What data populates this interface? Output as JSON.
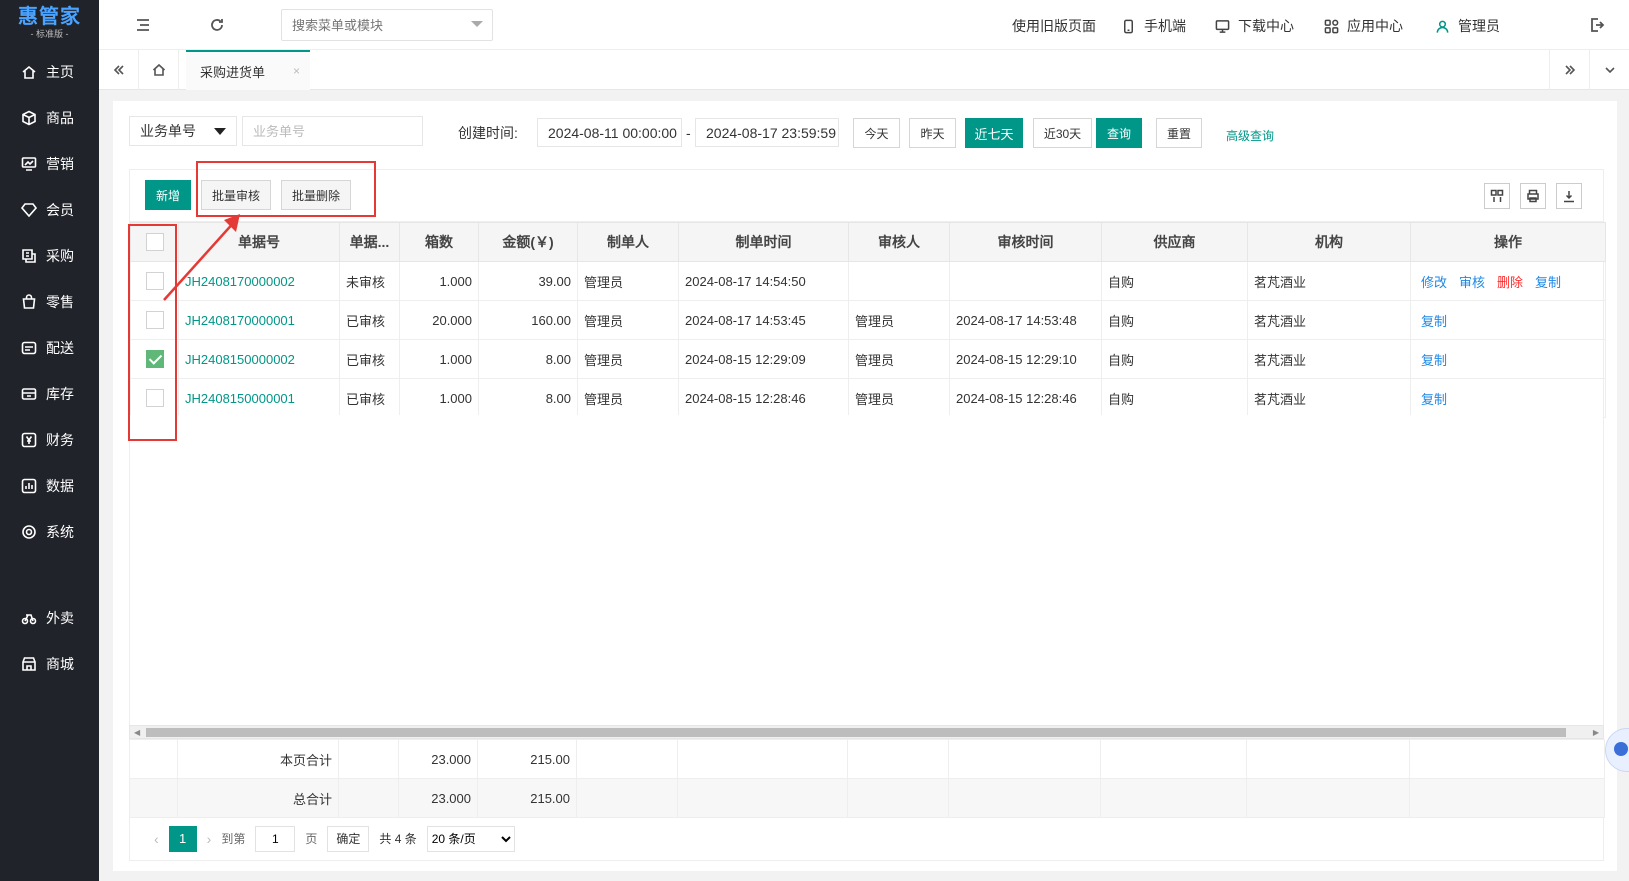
{
  "sidebar": {
    "brand": "惠管家",
    "edition": "- 标准版 -",
    "items": [
      {
        "label": "主页",
        "icon": "home-icon"
      },
      {
        "label": "商品",
        "icon": "cube-icon"
      },
      {
        "label": "营销",
        "icon": "chart-icon"
      },
      {
        "label": "会员",
        "icon": "diamond-icon"
      },
      {
        "label": "采购",
        "icon": "purchase-icon"
      },
      {
        "label": "零售",
        "icon": "bag-icon"
      },
      {
        "label": "配送",
        "icon": "truck-icon"
      },
      {
        "label": "库存",
        "icon": "box-icon"
      },
      {
        "label": "财务",
        "icon": "yen-icon"
      },
      {
        "label": "数据",
        "icon": "data-icon"
      },
      {
        "label": "系统",
        "icon": "settings-icon"
      },
      {
        "label": "外卖",
        "icon": "bike-icon"
      },
      {
        "label": "商城",
        "icon": "shop-icon"
      }
    ]
  },
  "header": {
    "search_placeholder": "搜索菜单或模块",
    "links": [
      {
        "label": "使用旧版页面",
        "icon": ""
      },
      {
        "label": "手机端",
        "icon": "mobile-icon"
      },
      {
        "label": "下载中心",
        "icon": "monitor-icon"
      },
      {
        "label": "应用中心",
        "icon": "apps-icon"
      },
      {
        "label": "管理员",
        "icon": "user-icon"
      }
    ]
  },
  "tabs": {
    "active": "采购进货单",
    "close": "×"
  },
  "filters": {
    "field_select": "业务单号",
    "field_placeholder": "业务单号",
    "created_label": "创建时间:",
    "start": "2024-08-11 00:00:00",
    "dash": "-",
    "end": "2024-08-17 23:59:59",
    "btn_today": "今天",
    "btn_yesterday": "昨天",
    "btn_7days": "近七天",
    "btn_30days": "近30天",
    "btn_query": "查询",
    "btn_reset": "重置",
    "advanced": "高级查询"
  },
  "toolbar": {
    "add": "新增",
    "batch_audit": "批量审核",
    "batch_delete": "批量删除"
  },
  "table": {
    "columns": [
      "单据号",
      "单据...",
      "箱数",
      "金额(￥)",
      "制单人",
      "制单时间",
      "审核人",
      "审核时间",
      "供应商",
      "机构",
      "操作"
    ],
    "rows": [
      {
        "no": "JH2408170000002",
        "status": "未审核",
        "boxes": "1.000",
        "amount": "39.00",
        "maker": "管理员",
        "made_at": "2024-08-17 14:54:50",
        "auditor": "",
        "audited_at": "",
        "supplier": "自购",
        "org": "茗芃酒业",
        "checked": false,
        "actions": [
          "修改",
          "审核",
          "删除",
          "复制"
        ]
      },
      {
        "no": "JH2408170000001",
        "status": "已审核",
        "boxes": "20.000",
        "amount": "160.00",
        "maker": "管理员",
        "made_at": "2024-08-17 14:53:45",
        "auditor": "管理员",
        "audited_at": "2024-08-17 14:53:48",
        "supplier": "自购",
        "org": "茗芃酒业",
        "checked": false,
        "actions": [
          "复制"
        ]
      },
      {
        "no": "JH2408150000002",
        "status": "已审核",
        "boxes": "1.000",
        "amount": "8.00",
        "maker": "管理员",
        "made_at": "2024-08-15 12:29:09",
        "auditor": "管理员",
        "audited_at": "2024-08-15 12:29:10",
        "supplier": "自购",
        "org": "茗芃酒业",
        "checked": true,
        "actions": [
          "复制"
        ]
      },
      {
        "no": "JH2408150000001",
        "status": "已审核",
        "boxes": "1.000",
        "amount": "8.00",
        "maker": "管理员",
        "made_at": "2024-08-15 12:28:46",
        "auditor": "管理员",
        "audited_at": "2024-08-15 12:28:46",
        "supplier": "自购",
        "org": "茗芃酒业",
        "checked": false,
        "actions": [
          "复制"
        ]
      }
    ]
  },
  "totals": {
    "page_label": "本页合计",
    "page_boxes": "23.000",
    "page_amount": "215.00",
    "all_label": "总合计",
    "all_boxes": "23.000",
    "all_amount": "215.00"
  },
  "pager": {
    "prev": "‹",
    "current": "1",
    "next": "›",
    "goto_label": "到第",
    "goto_value": "1",
    "page_unit": "页",
    "confirm": "确定",
    "total": "共 4 条",
    "page_size": "20 条/页"
  },
  "colors": {
    "accent": "#009688",
    "sidebar": "#20232a",
    "link": "#1e88e5",
    "danger": "#ff2d2d",
    "annotation": "#e53935"
  }
}
